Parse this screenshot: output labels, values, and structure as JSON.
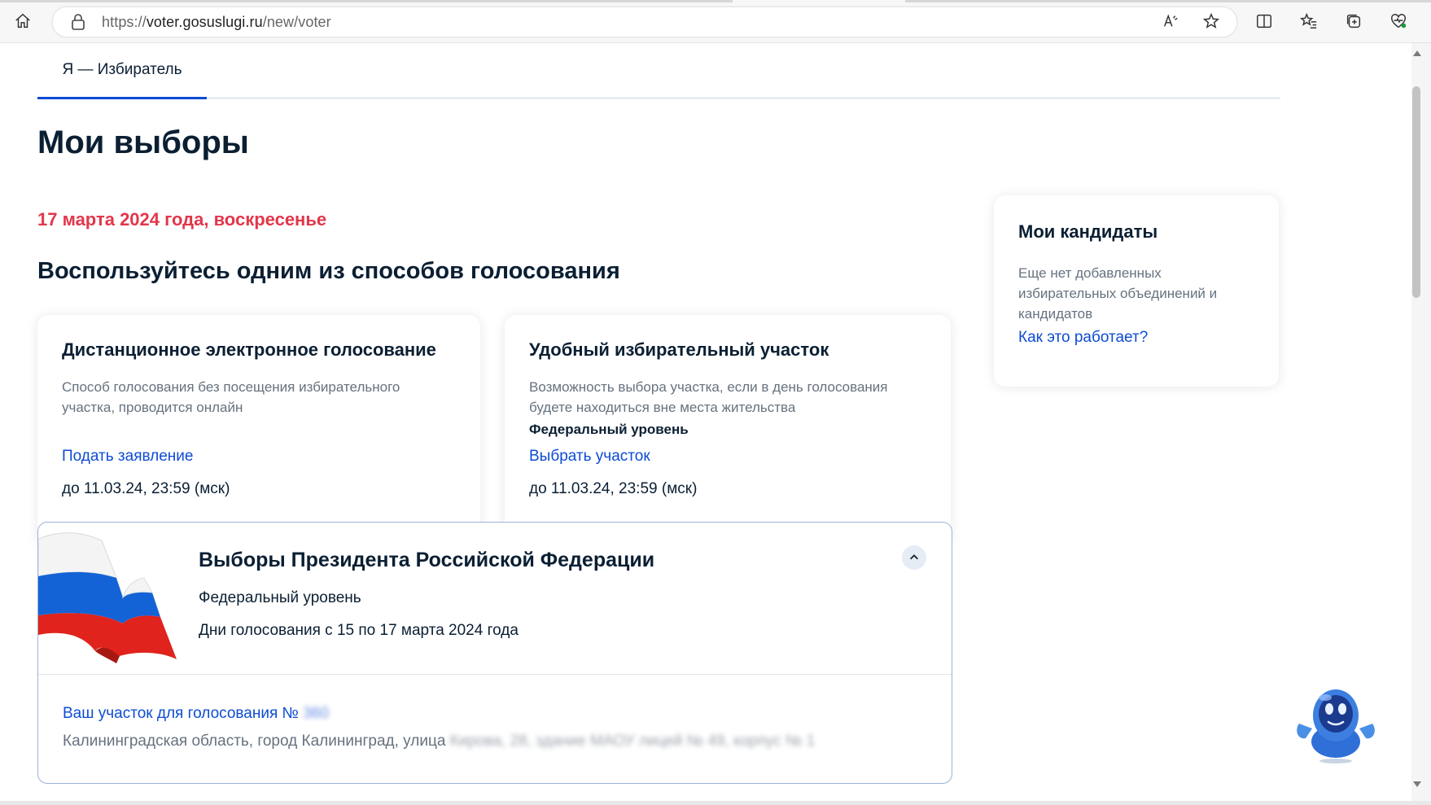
{
  "browser": {
    "url_prefix": "https://",
    "url_host": "voter.gosuslugi.ru",
    "url_path": "/new/voter"
  },
  "tabs": [
    {
      "label": "Я — Избиратель"
    }
  ],
  "page_title": "Мои выборы",
  "election_date": "17 марта 2024 года, воскресенье",
  "methods_heading": "Воспользуйтесь одним из способов голосования",
  "methods": [
    {
      "title": "Дистанционное электронное голосование",
      "description": "Способ голосования без посещения избирательного участка, проводится онлайн",
      "action": "Подать заявление",
      "deadline": "до 11.03.24, 23:59 (мск)"
    },
    {
      "title": "Удобный избирательный участок",
      "description": "Возможность выбора участка, если в день голосования будете находиться вне места жительства",
      "level": "Федеральный уровень",
      "action": "Выбрать участок",
      "deadline": "до 11.03.24, 23:59 (мск)"
    }
  ],
  "candidates": {
    "title": "Мои кандидаты",
    "description": "Еще нет добавленных избирательных объединений и кандидатов",
    "link": "Как это работает?"
  },
  "election": {
    "title": "Выборы Президента Российской Федерации",
    "level": "Федеральный уровень",
    "dates": "Дни голосования с 15 по 17 марта 2024 года",
    "precinct_link": "Ваш участок для голосования №",
    "precinct_number": "360",
    "address_visible": "Калининградская область, город Калининград, улица",
    "address_hidden": "Кирова, 28, здание МАОУ лицей № 49, корпус № 1"
  },
  "colors": {
    "accent": "#0d4cd3",
    "date_red": "#e1374b",
    "text": "#0b1f33",
    "muted": "#66727f"
  }
}
